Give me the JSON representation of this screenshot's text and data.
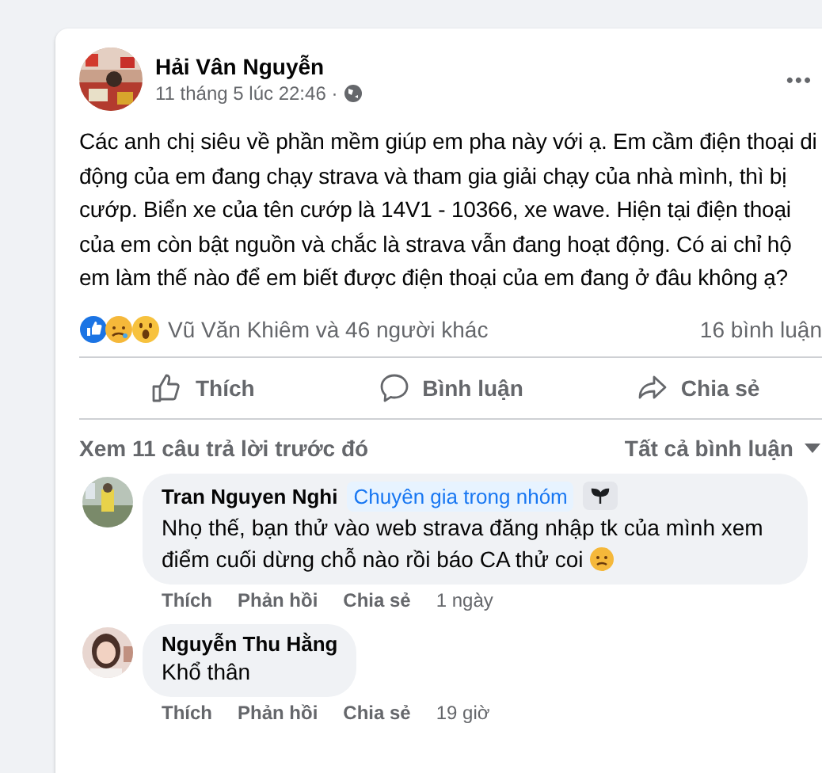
{
  "post": {
    "author": "Hải Vân Nguyễn",
    "time": "11 tháng 5 lúc 22:46 ·",
    "more": "•••",
    "text": "Các anh chị siêu về phần mềm giúp em pha này với ạ. Em cầm điện thoại di động của em đang chạy strava và tham gia giải chạy của nhà mình, thì bị cướp. Biển xe của tên cướp là 14V1 -  10366, xe wave. Hiện tại điện thoại của em còn bật nguồn và chắc là strava vẫn đang hoạt động. Có ai chỉ hộ em làm thế nào để em biết được điện thoại của em đang ở đâu không ạ?",
    "reactors": "Vũ Văn Khiêm và 46 người khác",
    "comment_count": "16 bình luận",
    "actions": [
      {
        "kind": "like",
        "label": "Thích"
      },
      {
        "kind": "comment",
        "label": "Bình luận"
      },
      {
        "kind": "share",
        "label": "Chia sẻ"
      }
    ]
  },
  "comments_header": {
    "previous": "Xem 11 câu trả lời trước đó",
    "filter": "Tất cả bình luận"
  },
  "comments": [
    {
      "author": "Tran Nguyen Nghi",
      "badge": "Chuyên gia trong nhóm",
      "text": "Nhọ thế, bạn thử vào web strava đăng nhập tk của mình xem điểm cuối dừng chỗ nào rồi báo CA thử coi",
      "emoji": true,
      "actions": [
        "Thích",
        "Phản hồi",
        "Chia sẻ"
      ],
      "age": "1 ngày"
    },
    {
      "author": "Nguyễn Thu Hằng",
      "text": "Khổ thân",
      "emoji": false,
      "actions": [
        "Thích",
        "Phản hồi",
        "Chia sẻ"
      ],
      "age": "19 giờ"
    }
  ]
}
